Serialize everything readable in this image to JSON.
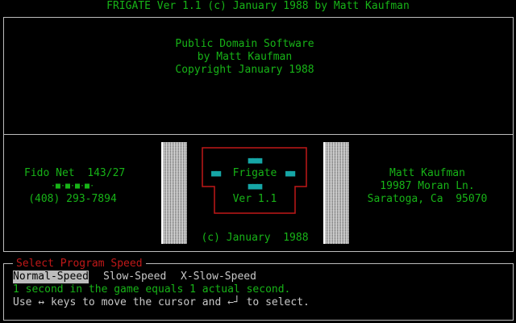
{
  "title_bar": "FRIGATE Ver 1.1 (c) January 1988 by Matt Kaufman",
  "top_panel": {
    "line1": "Public Domain Software",
    "line2": "by Matt Kaufman",
    "line3": "Copyright January 1988"
  },
  "left_info": {
    "fido": "Fido Net  143/27",
    "dots": "·■·■·■·■·",
    "phone": "(408) 293-7894"
  },
  "logo": {
    "top_marks": "■■■",
    "left_marks": "■■",
    "name": "Frigate",
    "right_marks": "■■",
    "mid_marks": "■■■",
    "version": "Ver 1.1",
    "copyright": "(c) January  1988"
  },
  "right_info": {
    "name": "Matt Kaufman",
    "street": "19987 Moran Ln.",
    "city": "Saratoga, Ca  95070"
  },
  "speed_menu": {
    "heading": "Select Program Speed",
    "options": [
      "Normal-Speed",
      "Slow-Speed",
      "X-Slow-Speed"
    ],
    "selected": "Normal-Speed",
    "description": "1 second in the game equals 1 actual second.",
    "instructions": "Use ↔ keys to move the cursor and ←┘ to select."
  },
  "colors": {
    "text_green": "#17b317",
    "accent_cyan": "#16a6a6",
    "frame_red": "#c01818",
    "border_gray": "#bcbcbc"
  }
}
